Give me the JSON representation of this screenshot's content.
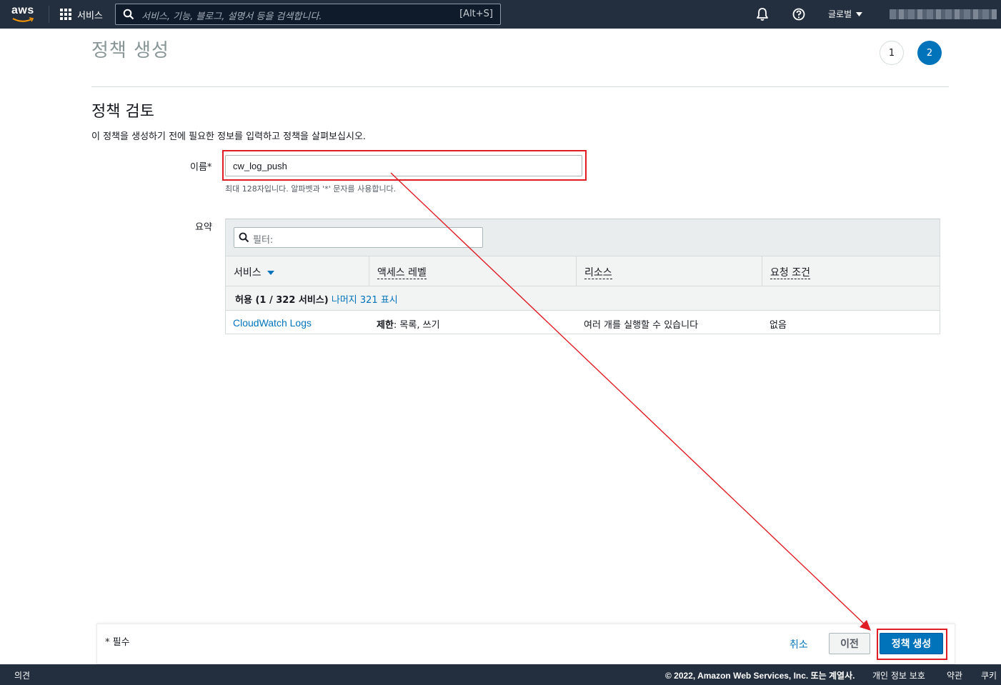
{
  "nav": {
    "logo_text": "aws",
    "services_label": "서비스",
    "search_placeholder": "서비스, 기능, 블로그, 설명서 등을 검색합니다.",
    "search_shortcut": "[Alt+S]",
    "region_label": "글로벌",
    "icons": [
      "grid-icon",
      "search-icon",
      "bell-icon",
      "help-icon",
      "caret-down-icon"
    ]
  },
  "page": {
    "title": "정책 생성",
    "steps": [
      "1",
      "2"
    ],
    "active_step": "2"
  },
  "review": {
    "section_title": "정책 검토",
    "description": "이 정책을 생성하기 전에 필요한 정보를 입력하고 정책을 살펴보십시오.",
    "name_label": "이름*",
    "name_value": "cw_log_push",
    "name_hint": "최대 128자입니다. 알파벳과 '*' 문자를 사용합니다.",
    "summary_label": "요약"
  },
  "summary_table": {
    "filter_placeholder": "필터:",
    "columns": [
      "서비스",
      "액세스 레벨",
      "리소스",
      "요청 조건"
    ],
    "group_label": "허용 (1 / 322 서비스)",
    "group_link": "나머지 321 표시",
    "rows": [
      {
        "service": "CloudWatch Logs",
        "access_level_bold": "제한",
        "access_level_rest": ": 목록, 쓰기",
        "resource": "여러 개를 실행할 수 있습니다",
        "condition": "없음"
      }
    ]
  },
  "actions": {
    "required_note": "* 필수",
    "cancel": "취소",
    "previous": "이전",
    "create": "정책 생성"
  },
  "footer": {
    "feedback": "의견",
    "copyright": "© 2022, Amazon Web Services, Inc. 또는 계열사.",
    "privacy": "개인 정보 보호",
    "terms": "약관",
    "cookies": "쿠키"
  },
  "colors": {
    "nav_bg": "#232f3e",
    "primary": "#0073bb",
    "annotation": "#e01d24"
  }
}
